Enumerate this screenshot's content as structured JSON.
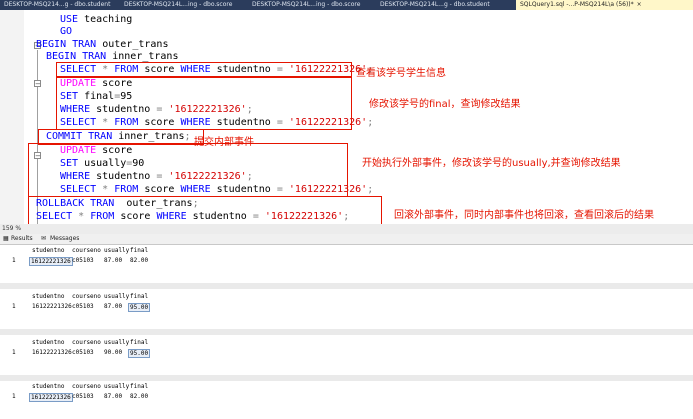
{
  "tabs": [
    "DESKTOP-MSQ214...g - dbo.student",
    "DESKTOP-MSQ214L...ing - dbo.score",
    "DESKTOP-MSQ214L...ing - dbo.score",
    "DESKTOP-MSQ214L...g - dbo.student",
    "SQLQuery1.sql -...P-MSQ214L\\a (56))*"
  ],
  "tab_close": "×",
  "code": {
    "use": "USE",
    "db": "teaching",
    "go": "GO",
    "begin": "BEGIN TRAN",
    "outer": "outer_trans",
    "begin2": "BEGIN TRAN",
    "inner": "inner_trans",
    "select": "SELECT",
    "star": "*",
    "from": "FROM",
    "tbl": "score",
    "where": "WHERE",
    "col_sno": "studentno",
    "eq": "=",
    "sno": "'16122221326'",
    "semi": ";",
    "update": "UPDATE",
    "set": "SET",
    "final": "final",
    "v95": "95",
    "commit": "COMMIT TRAN",
    "usually": "usually",
    "v90": "90",
    "rollback": "ROLLBACK TRAN"
  },
  "annotations": {
    "a1": "查看该学号学生信息",
    "a2": "修改该学号的final，查询修改结果",
    "a3": "提交内部事件",
    "a4": "开始执行外部事件，修改该学号的usually,并查询修改结果",
    "a5": "回滚外部事件，同时内部事件也将回滚，查看回滚后的结果"
  },
  "zoom": "159 %",
  "results_tabs": {
    "results": "Results",
    "messages": "Messages"
  },
  "grid_headers": [
    "studentno",
    "courseno",
    "usually",
    "final"
  ],
  "grids": [
    {
      "row": "1",
      "cells": [
        "16122221326",
        "c05103",
        "87.00",
        "82.00"
      ]
    },
    {
      "row": "1",
      "cells": [
        "16122221326",
        "c05103",
        "87.00",
        "95.00"
      ]
    },
    {
      "row": "1",
      "cells": [
        "16122221326",
        "c05103",
        "90.00",
        "95.00"
      ]
    },
    {
      "row": "1",
      "cells": [
        "16122221326",
        "c05103",
        "87.00",
        "82.00"
      ]
    }
  ]
}
